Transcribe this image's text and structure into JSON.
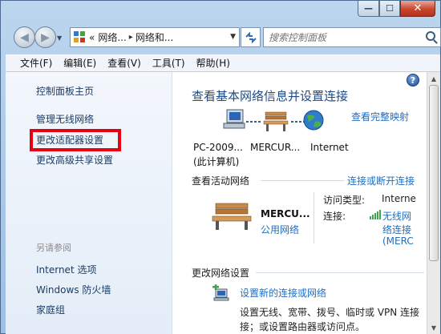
{
  "window": {
    "minimize_glyph": "—",
    "maximize_glyph": "☐",
    "close_glyph": "✕"
  },
  "address_bar": {
    "crumbs": [
      "网络...",
      "网络和..."
    ],
    "separator": "▸",
    "prefix": "«"
  },
  "search": {
    "placeholder": "搜索控制面板"
  },
  "menu": [
    "文件(F)",
    "编辑(E)",
    "查看(V)",
    "工具(T)",
    "帮助(H)"
  ],
  "sidebar": {
    "items": [
      "控制面板主页",
      "管理无线网络",
      "更改适配器设置",
      "更改高级共享设置"
    ],
    "see_also_label": "另请参阅",
    "see_also": [
      "Internet 选项",
      "Windows 防火墙",
      "家庭组"
    ],
    "highlight_color": "#e60012"
  },
  "main": {
    "title": "查看基本网络信息并设置连接",
    "full_map_link": "查看完整映射",
    "map": {
      "node1_line1": "PC-2009...",
      "node1_line2": "(此计算机)",
      "node2": "MERCUR...",
      "node3": "Internet"
    },
    "active_header": "查看活动网络",
    "connect_link": "连接或断开连接",
    "network_name": "MERCU...",
    "network_type": "公用网络",
    "access_type_label": "访问类型:",
    "access_type_value": "Interne",
    "connection_label": "连接:",
    "connection_lines": [
      "无线网",
      "络连接",
      "(MERC"
    ],
    "change_header": "更改网络设置",
    "setup_link": "设置新的连接或网络",
    "setup_desc_line1": "设置无线、宽带、拨号、临时或 VPN 连接",
    "setup_desc_line2": "接；或设置路由器或访问点。"
  },
  "colors": {
    "link": "#1f6ec2",
    "title": "#1e4b87",
    "accent_red": "#e60012"
  },
  "icons": [
    "computer-icon",
    "bench-icon",
    "globe-icon",
    "help-icon",
    "search-icon",
    "refresh-icon",
    "signal-icon",
    "setup-network-icon"
  ]
}
